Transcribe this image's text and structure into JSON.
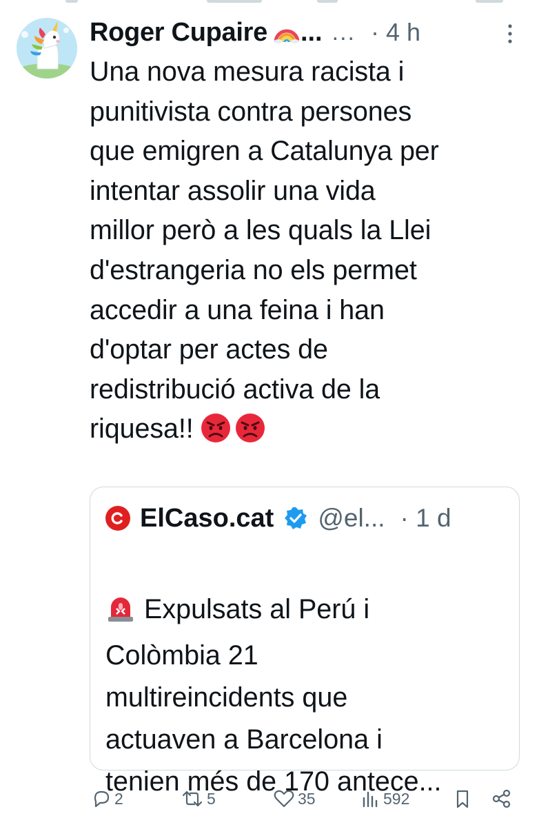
{
  "tweet": {
    "author_name": "Roger Cupaire",
    "name_truncation": "...",
    "handle_truncation": "...",
    "timestamp": "· 4 h",
    "text": "Una nova mesura racista i\npunitivista contra persones\nque emigren a Catalunya per\nintentar assolir una vida\nmillor però a les quals la Llei\nd'estrangeria no els permet\naccedir a una feina i han\nd'optar per actes de\nredistribució activa de la\nriquesa!!",
    "avatar_icon": "unicorn-avatar",
    "name_emoji_icon": "rainbow-icon",
    "trailing_emoji_icons": [
      "angry-face-icon",
      "angry-face-icon"
    ]
  },
  "quote": {
    "source_logo_icon": "elcaso-logo-icon",
    "source_name": "ElCaso.cat",
    "verified_icon": "verified-badge-icon",
    "handle": "@el...",
    "timestamp": "· 1 d",
    "siren_icon": "police-siren-icon",
    "text": "Expulsats al Perú i\nColòmbia 21\nmultireincidents que\nactuaven a Barcelona i\ntenien més de 170 antece..."
  },
  "actions": {
    "replies": "2",
    "reposts": "5",
    "likes": "35",
    "views": "592"
  },
  "colors": {
    "text": "#0f1419",
    "secondary": "#536471",
    "border": "#cfd9de",
    "verified": "#1d9bf0",
    "brand_red": "#e02020"
  }
}
